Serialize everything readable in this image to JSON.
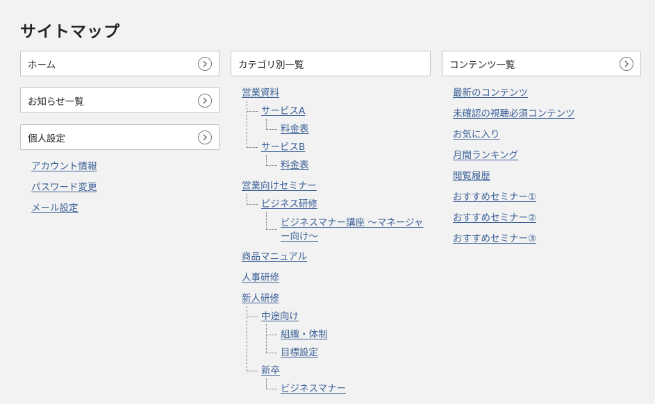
{
  "page_title": "サイトマップ",
  "col1": {
    "boxes": [
      {
        "label": "ホーム"
      },
      {
        "label": "お知らせ一覧"
      },
      {
        "label": "個人設定"
      }
    ],
    "links": [
      "アカウント情報",
      "パスワード変更",
      "メール設定"
    ]
  },
  "col2": {
    "box_label": "カテゴリ別一覧",
    "tree": {
      "eigyo": "営業資料",
      "serviceA": "サービスA",
      "ryokinA": "料金表",
      "serviceB": "サービスB",
      "ryokinB": "料金表",
      "seminar": "営業向けセミナー",
      "business_kenshu": "ビジネス研修",
      "manner_koza": "ビジネスマナー講座 〜マネージャー向け〜",
      "shohin": "商品マニュアル",
      "jinji": "人事研修",
      "shinjin": "新人研修",
      "chuto": "中途向け",
      "soshiki": "組織・体制",
      "mokuhyo": "目標設定",
      "shinsotsu": "新卒",
      "business_manner": "ビジネスマナー"
    }
  },
  "col3": {
    "box_label": "コンテンツ一覧",
    "links": [
      "最新のコンテンツ",
      "未確認の視聴必須コンテンツ",
      "お気に入り",
      "月間ランキング",
      "閲覧履歴",
      "おすすめセミナー①",
      "おすすめセミナー②",
      "おすすめセミナー③"
    ]
  }
}
